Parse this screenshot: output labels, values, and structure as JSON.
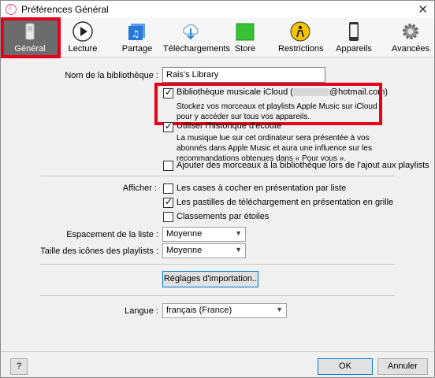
{
  "window": {
    "title": "Préférences Général",
    "close_glyph": "✕"
  },
  "toolbar": {
    "items": [
      {
        "label": "Général",
        "icon": "general-switch-icon",
        "selected": true
      },
      {
        "label": "Lecture",
        "icon": "play-icon"
      },
      {
        "label": "Partage",
        "icon": "shared-music-icon"
      },
      {
        "label": "Téléchargements",
        "icon": "cloud-download-icon"
      },
      {
        "label": "Store",
        "icon": "store-green-icon"
      },
      {
        "label": "Restrictions",
        "icon": "restrictions-icon"
      },
      {
        "label": "Appareils",
        "icon": "phone-icon"
      },
      {
        "label": "Avancées",
        "icon": "gear-icon"
      }
    ]
  },
  "library": {
    "name_label": "Nom de la bibliothèque :",
    "name_value": "Rais's Library"
  },
  "icloud": {
    "checkbox_label": "Bibliothèque musicale iCloud (",
    "email_domain": "@hotmail.com)",
    "checked": true,
    "description": "Stockez vos morceaux et playlists Apple Music sur iCloud pour y accéder sur tous vos appareils."
  },
  "listening_history": {
    "checkbox_label": "Utiliser l'historique d'écoute",
    "checked": true,
    "description": "La musique lue sur cet ordinateur sera présentée à vos abonnés dans Apple Music et aura une influence sur les recommandations obtenues dans « Pour vous »."
  },
  "add_to_library": {
    "checkbox_label": "Ajouter des morceaux à la bibliothèque lors de l'ajout aux playlists",
    "checked": false
  },
  "display": {
    "label": "Afficher :",
    "options": [
      {
        "label": "Les cases à cocher en présentation par liste",
        "checked": false
      },
      {
        "label": "Les pastilles de téléchargement en présentation en grille",
        "checked": true
      },
      {
        "label": "Classements par étoiles",
        "checked": false
      }
    ]
  },
  "list_spacing": {
    "label": "Espacement de la liste :",
    "value": "Moyenne"
  },
  "playlist_icon_size": {
    "label": "Taille des icônes des playlists :",
    "value": "Moyenne"
  },
  "import_settings_button": "Réglages d'importation..",
  "language": {
    "label": "Langue :",
    "value": "français (France)"
  },
  "footer": {
    "help": "?",
    "ok": "OK",
    "cancel": "Annuler"
  },
  "colors": {
    "highlight_red": "#e5001c",
    "selected_tab_bg": "#6c6c6c"
  }
}
